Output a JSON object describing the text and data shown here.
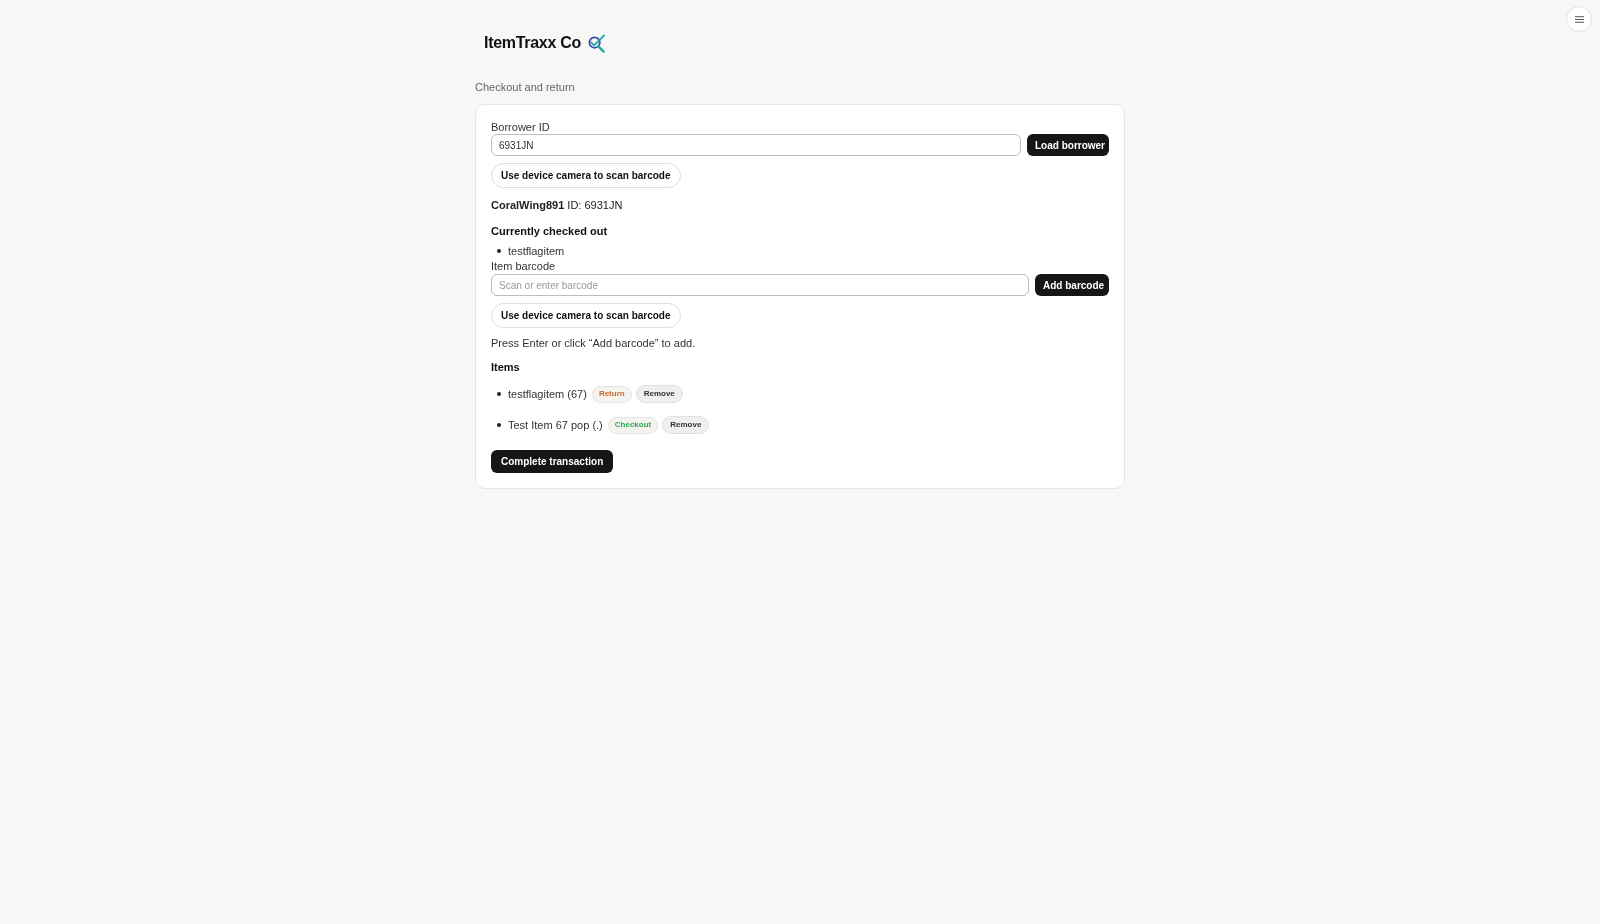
{
  "header": {
    "brand": "ItemTraxx Co"
  },
  "page_title": "Checkout and return",
  "borrower": {
    "label": "Borrower ID",
    "value": "6931JN",
    "load_button": "Load borrower",
    "camera_button": "Use device camera to scan barcode"
  },
  "borrower_summary": "**CoralWing891** ID: 6931JN",
  "checked_out": {
    "heading": "Currently checked out",
    "items": [
      "testflagitem"
    ]
  },
  "barcode": {
    "label": "Item barcode",
    "placeholder": "Scan or enter barcode",
    "add_button": "Add barcode",
    "camera_button": "Use device camera to scan barcode",
    "hint": "Press Enter or click “Add barcode” to add."
  },
  "items": {
    "heading": "Items",
    "rows": [
      {
        "name": "testflagitem (67)",
        "kind": "return",
        "action": "Return",
        "remove": "Remove"
      },
      {
        "name": "Test Item 67 pop (.)",
        "kind": "checkout",
        "action": "Checkout",
        "remove": "Remove"
      }
    ]
  },
  "complete_button": "Complete transaction"
}
